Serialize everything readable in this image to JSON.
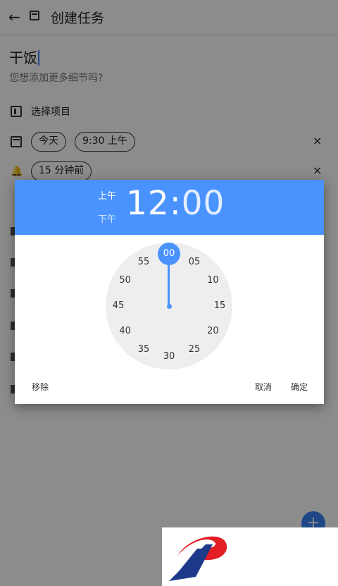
{
  "appbar": {
    "title": "创建任务",
    "back_icon": "arrow-left-icon",
    "calendar_icon": "calendar-icon"
  },
  "task": {
    "title": "干饭",
    "details_placeholder": "您想添加更多细节吗?"
  },
  "project": {
    "label": "选择项目"
  },
  "date": {
    "day": "今天",
    "time": "9:30 上午",
    "clear": "×"
  },
  "reminder": {
    "value": "15 分钟前",
    "clear": "×"
  },
  "fab": {
    "symbol": "+"
  },
  "time_picker": {
    "am": "上午",
    "pm": "下午",
    "hour": "12",
    "separator": ":",
    "minute": "00",
    "selected_minute": "00",
    "minutes": [
      "05",
      "10",
      "15",
      "20",
      "25",
      "30",
      "35",
      "40",
      "45",
      "50",
      "55"
    ],
    "remove_label": "移除",
    "cancel_label": "取消",
    "ok_label": "确定",
    "accent_color": "#4a93ff"
  }
}
